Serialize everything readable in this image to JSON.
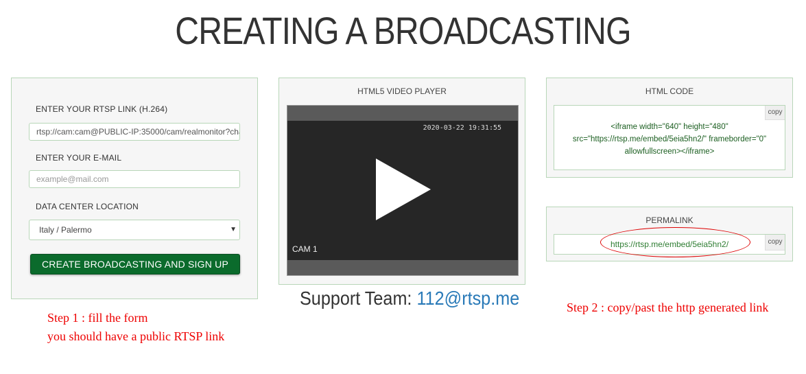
{
  "page": {
    "title": "CREATING A BROADCASTING"
  },
  "form": {
    "rtsp_label": "ENTER YOUR RTSP LINK (H.264)",
    "rtsp_value": "rtsp://cam:cam@PUBLIC-IP:35000/cam/realmonitor?chann",
    "email_label": "ENTER YOUR E-MAIL",
    "email_placeholder": "example@mail.com",
    "location_label": "DATA CENTER LOCATION",
    "location_selected": "Italy / Palermo",
    "submit_label": "CREATE BROADCASTING AND SIGN UP"
  },
  "player": {
    "title": "HTML5 VIDEO PLAYER",
    "timestamp": "2020-03-22 19:31:55",
    "camera_label": "CAM 1"
  },
  "html_code": {
    "title": "HTML CODE",
    "line1": "<iframe width=\"640\" height=\"480\"",
    "line2": "src=\"https://rtsp.me/embed/5eia5hn2/\" frameborder=\"0\"",
    "line3": "allowfullscreen></iframe>",
    "copy_label": "copy"
  },
  "permalink": {
    "title": "PERMALINK",
    "url": "https://rtsp.me/embed/5eia5hn2/",
    "copy_label": "copy"
  },
  "support": {
    "prefix": "Support Team: ",
    "email": "112@rtsp.me"
  },
  "notes": {
    "step1_line1": "Step 1 : fill the form",
    "step1_line2": "you should have a public RTSP link",
    "step2": "Step 2 : copy/past the http generated link"
  },
  "colors": {
    "accent_green": "#0b6b2c",
    "annotation_red": "#e00000",
    "link_blue": "#2a7ab8"
  }
}
